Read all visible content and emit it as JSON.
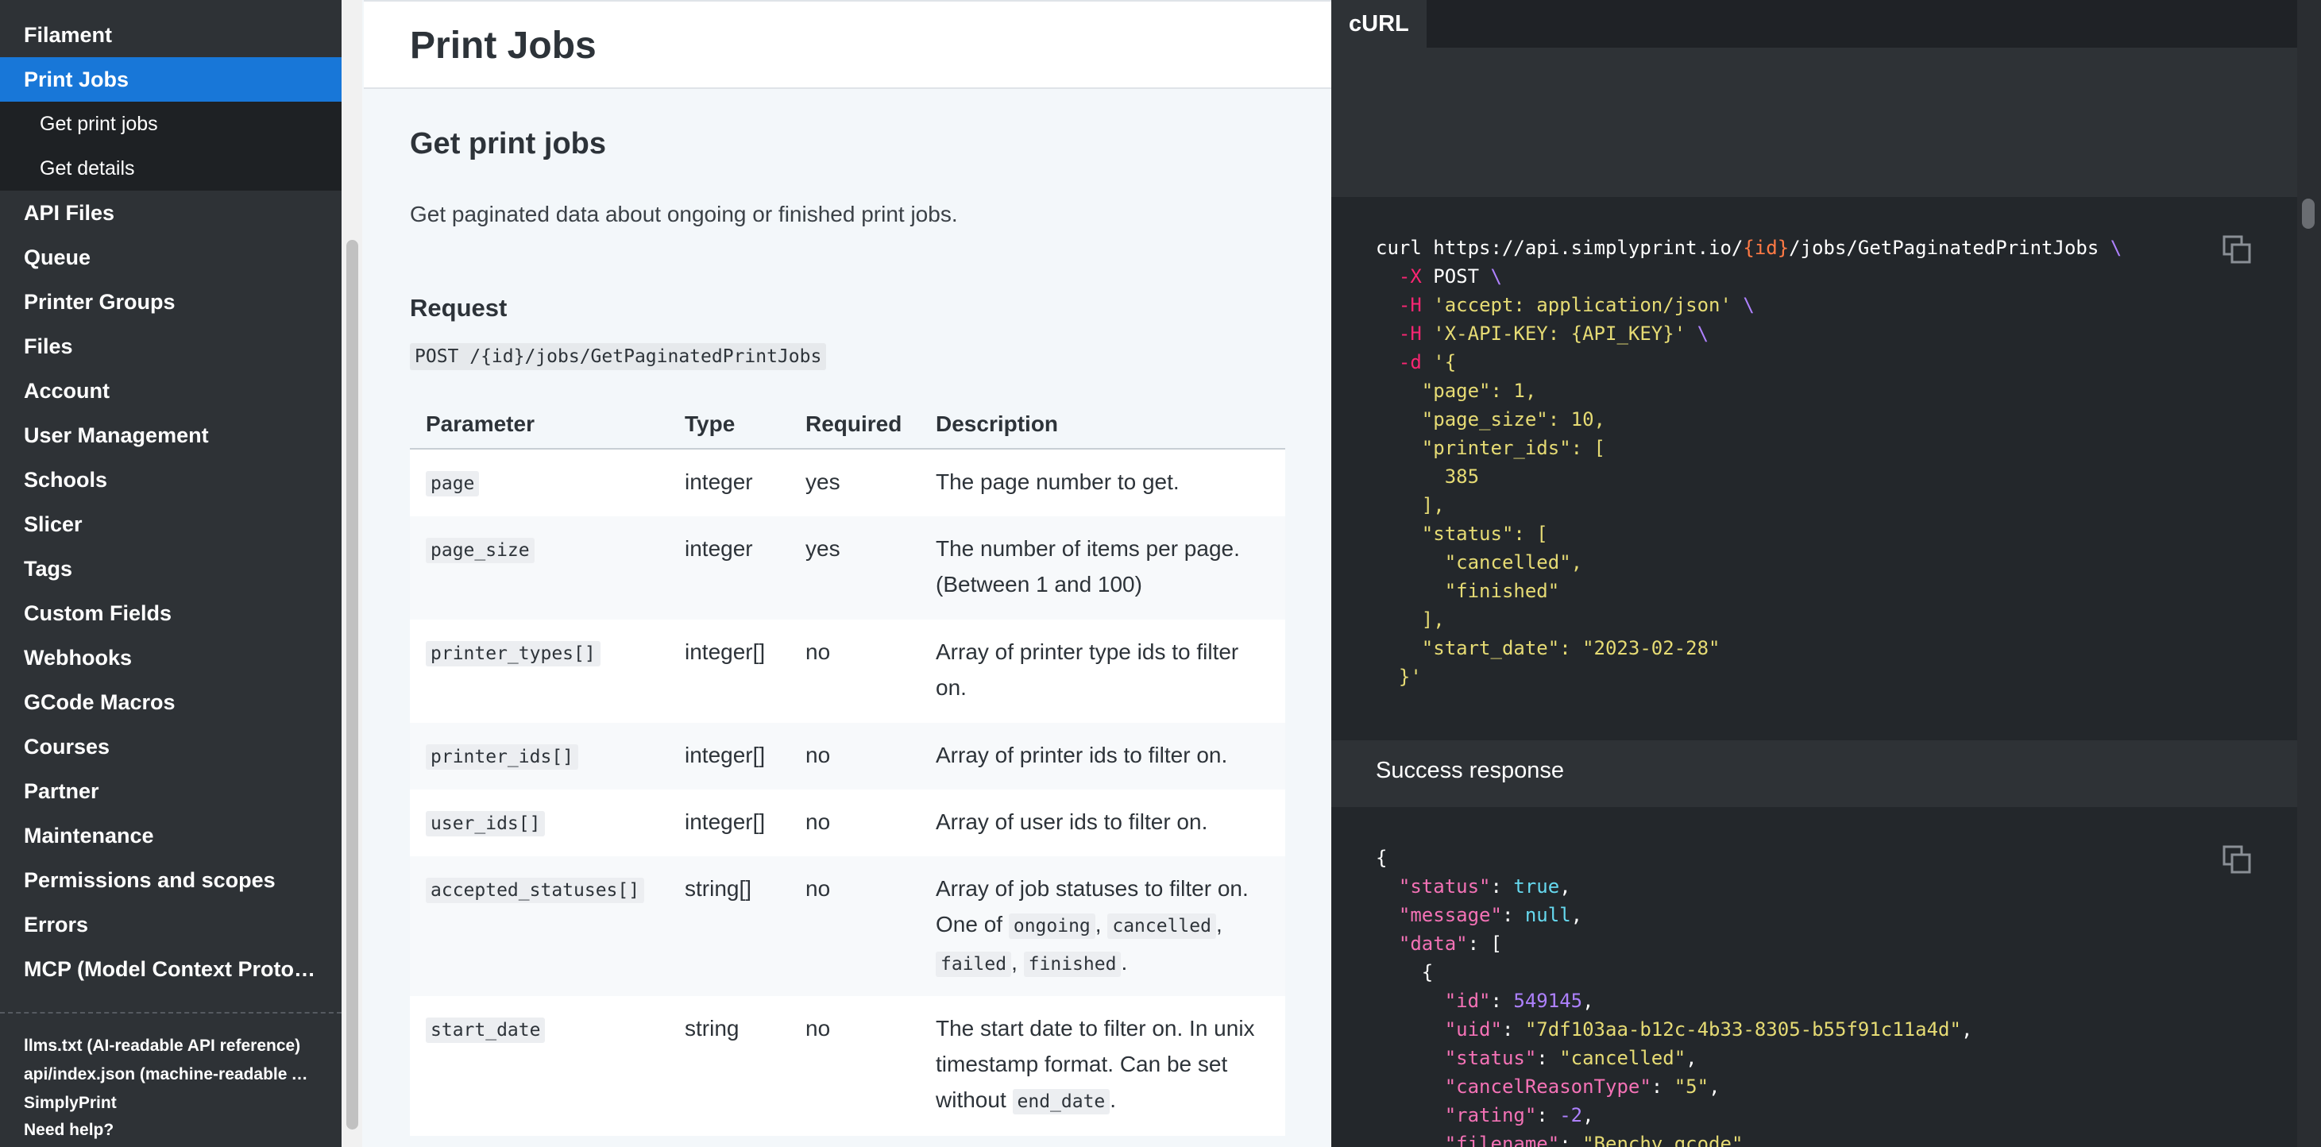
{
  "sidebar": {
    "items": [
      {
        "label": "Filament"
      },
      {
        "label": "Print Jobs",
        "active": true
      },
      {
        "label": "Get print jobs",
        "sub": true
      },
      {
        "label": "Get details",
        "sub": true
      },
      {
        "label": "API Files"
      },
      {
        "label": "Queue"
      },
      {
        "label": "Printer Groups"
      },
      {
        "label": "Files"
      },
      {
        "label": "Account"
      },
      {
        "label": "User Management"
      },
      {
        "label": "Schools"
      },
      {
        "label": "Slicer"
      },
      {
        "label": "Tags"
      },
      {
        "label": "Custom Fields"
      },
      {
        "label": "Webhooks"
      },
      {
        "label": "GCode Macros"
      },
      {
        "label": "Courses"
      },
      {
        "label": "Partner"
      },
      {
        "label": "Maintenance"
      },
      {
        "label": "Permissions and scopes"
      },
      {
        "label": "Errors"
      },
      {
        "label": "MCP (Model Context Protocol)"
      }
    ],
    "footer_links": [
      "llms.txt (AI-readable API reference)",
      "api/index.json (machine-readable API spec)",
      "SimplyPrint",
      "Need help?"
    ]
  },
  "main": {
    "page_title": "Print Jobs",
    "section_title": "Get print jobs",
    "section_description": "Get paginated data about ongoing or finished print jobs.",
    "request_title": "Request",
    "endpoint": "POST /{id}/jobs/GetPaginatedPrintJobs",
    "table": {
      "headers": [
        "Parameter",
        "Type",
        "Required",
        "Description"
      ],
      "rows": [
        {
          "param": "page",
          "type": "integer",
          "required": "yes",
          "desc_lines": [
            "The page number to get."
          ]
        },
        {
          "param": "page_size",
          "type": "integer",
          "required": "yes",
          "desc_lines": [
            "The number of items per page.",
            "(Between 1 and 100)"
          ]
        },
        {
          "param": "printer_types[]",
          "type": "integer[]",
          "required": "no",
          "desc_lines": [
            "Array of printer type ids to filter",
            "on."
          ]
        },
        {
          "param": "printer_ids[]",
          "type": "integer[]",
          "required": "no",
          "desc_lines": [
            "Array of printer ids to filter on."
          ]
        },
        {
          "param": "user_ids[]",
          "type": "integer[]",
          "required": "no",
          "desc_lines": [
            "Array of user ids to filter on."
          ]
        },
        {
          "param": "accepted_statuses[]",
          "type": "string[]",
          "required": "no",
          "desc_lines": [
            "Array of job statuses to filter on.",
            "One of"
          ],
          "desc_codes": [
            "ongoing",
            "cancelled",
            "failed",
            "finished"
          ]
        },
        {
          "param": "start_date",
          "type": "string",
          "required": "no",
          "desc_lines": [
            "The start date to filter on. In unix",
            "timestamp format. Can be set",
            "without"
          ],
          "desc_code_end": "end_date"
        }
      ]
    }
  },
  "right_panel": {
    "tab_label": "cURL",
    "request_code": [
      "curl https://api.simplyprint.io/{id}/jobs/GetPaginatedPrintJobs \\",
      "  -X POST \\",
      "  -H 'accept: application/json' \\",
      "  -H 'X-API-KEY: {API_KEY}' \\",
      "  -d '{",
      "    \"page\": 1,",
      "    \"page_size\": 10,",
      "    \"printer_ids\": [",
      "      385",
      "    ],",
      "    \"status\": [",
      "      \"cancelled\",",
      "      \"finished\"",
      "    ],",
      "    \"start_date\": \"2023-02-28\"",
      "  }'"
    ],
    "response_label": "Success response",
    "response_code": [
      "{",
      "  \"status\": true,",
      "  \"message\": null,",
      "  \"data\": [",
      "    {",
      "      \"id\": 549145,",
      "      \"uid\": \"7df103aa-b12c-4b33-8305-b55f91c11a4d\",",
      "      \"status\": \"cancelled\",",
      "      \"cancelReasonType\": \"5\",",
      "      \"rating\": -2,",
      "      \"filename\": \"Benchy.gcode\","
    ]
  },
  "colors": {
    "accent": "#1877d8",
    "sidebar_bg": "#2e3236",
    "code_bg": "#23272b"
  }
}
